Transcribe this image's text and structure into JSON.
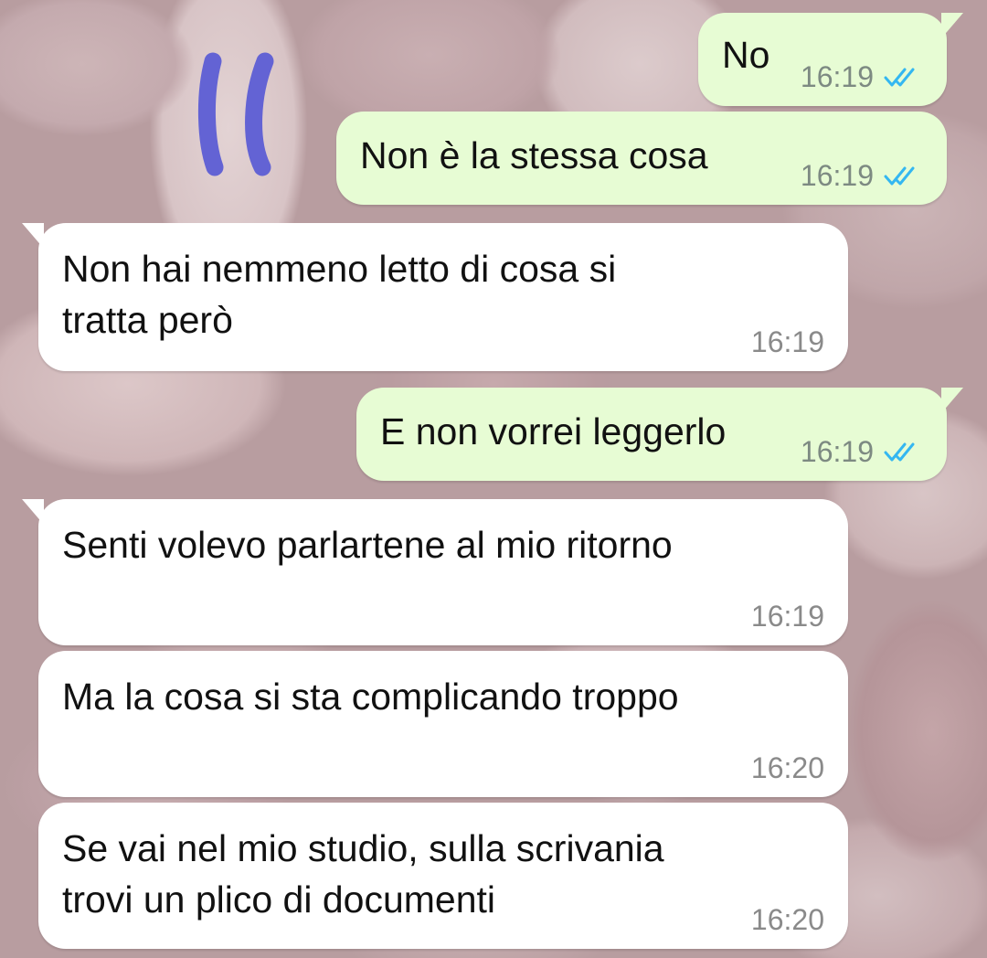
{
  "chat": {
    "messages": [
      {
        "direction": "out",
        "text": "No",
        "time": "16:19",
        "status": "read-double-check-icon"
      },
      {
        "direction": "out",
        "text": "Non è la stessa cosa",
        "time": "16:19",
        "status": "read-double-check-icon"
      },
      {
        "direction": "in",
        "text": "Non hai nemmeno letto di cosa si\ntratta però",
        "time": "16:19"
      },
      {
        "direction": "out",
        "text": "E non vorrei leggerlo",
        "time": "16:19",
        "status": "read-double-check-icon"
      },
      {
        "direction": "in",
        "text": "Senti volevo parlartene al mio ritorno",
        "time": "16:19"
      },
      {
        "direction": "in",
        "text": "Ma la cosa si sta complicando troppo",
        "time": "16:20"
      },
      {
        "direction": "in",
        "text": "Se vai nel mio studio, sulla scrivania\ntrovi un plico di documenti",
        "time": "16:20"
      }
    ]
  },
  "colors": {
    "outgoing_bubble": "#e7fcd4",
    "incoming_bubble": "#ffffff",
    "read_tick": "#34b7f1",
    "annotation_marker": "#6363d4"
  }
}
